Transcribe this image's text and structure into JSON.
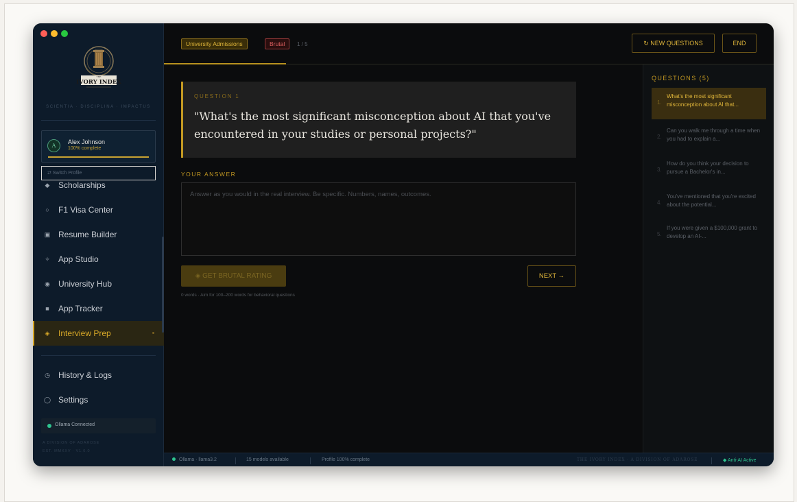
{
  "sidebar": {
    "motto": "SCIENTIA · DISCIPLINA · IMPACTUS",
    "logo_text": "IVORY INDEX",
    "logo_top_text": "THE",
    "profile": {
      "name": "Alex Johnson",
      "completion": "100% complete",
      "avatar_letter": "A"
    },
    "switch_profile": "⇄  Switch Profile",
    "nav": [
      {
        "label": "Scholarships",
        "icon": "diamond-icon",
        "glyph": "◆"
      },
      {
        "label": "F1 Visa Center",
        "icon": "circle-icon",
        "glyph": "○"
      },
      {
        "label": "Resume Builder",
        "icon": "document-icon",
        "glyph": "▣"
      },
      {
        "label": "App Studio",
        "icon": "sparkle-icon",
        "glyph": "✧"
      },
      {
        "label": "University Hub",
        "icon": "target-icon",
        "glyph": "◉"
      },
      {
        "label": "App Tracker",
        "icon": "square-icon",
        "glyph": "■"
      },
      {
        "label": "Interview Prep",
        "icon": "diamond-outline-icon",
        "glyph": "◈",
        "active": true
      },
      {
        "label": "History & Logs",
        "icon": "clock-icon",
        "glyph": "◷"
      },
      {
        "label": "Settings",
        "icon": "gear-icon",
        "glyph": "◯"
      }
    ],
    "ollama_status": "Ollama Connected",
    "division": "A DIVISION OF ADAROSE",
    "est": "EST. MMXXV · V1.0.0"
  },
  "header": {
    "category_tag": "University Admissions",
    "difficulty_tag": "Brutal",
    "counter": "1 / 5",
    "new_questions": "↻ NEW QUESTIONS",
    "end": "END"
  },
  "question": {
    "label": "QUESTION 1",
    "text": "\"What's the most significant misconception about AI that you've encountered in your studies or personal projects?\""
  },
  "answer": {
    "label": "YOUR ANSWER",
    "placeholder": "Answer as you would in the real interview. Be specific. Numbers, names, outcomes.",
    "brutal_button": "◈ GET BRUTAL RATING",
    "next_button": "NEXT →",
    "hint": "0 words · Aim for 100–200 words for behavioral questions"
  },
  "questions_panel": {
    "title": "QUESTIONS (5)",
    "items": [
      {
        "num": "1.",
        "text": "What's the most significant misconception about AI that..."
      },
      {
        "num": "2.",
        "text": "Can you walk me through a time when you had to explain a..."
      },
      {
        "num": "3.",
        "text": "How do you think your decision to pursue a Bachelor's in..."
      },
      {
        "num": "4.",
        "text": "You've mentioned that you're excited about the potential..."
      },
      {
        "num": "5.",
        "text": "If you were given a $100,000 grant to develop an AI-..."
      }
    ]
  },
  "statusbar": {
    "model": "Ollama · llama3.2",
    "models": "15 models available",
    "profile": "Profile 100% complete",
    "brand": "THE IVORY INDEX · A DIVISION OF ADAROSE",
    "anti_ai": "◆ Anti-AI Active"
  },
  "colors": {
    "accent": "#c29822",
    "sidebar": "#0d1b2a",
    "green": "#2ec58f",
    "danger": "#e06060"
  }
}
